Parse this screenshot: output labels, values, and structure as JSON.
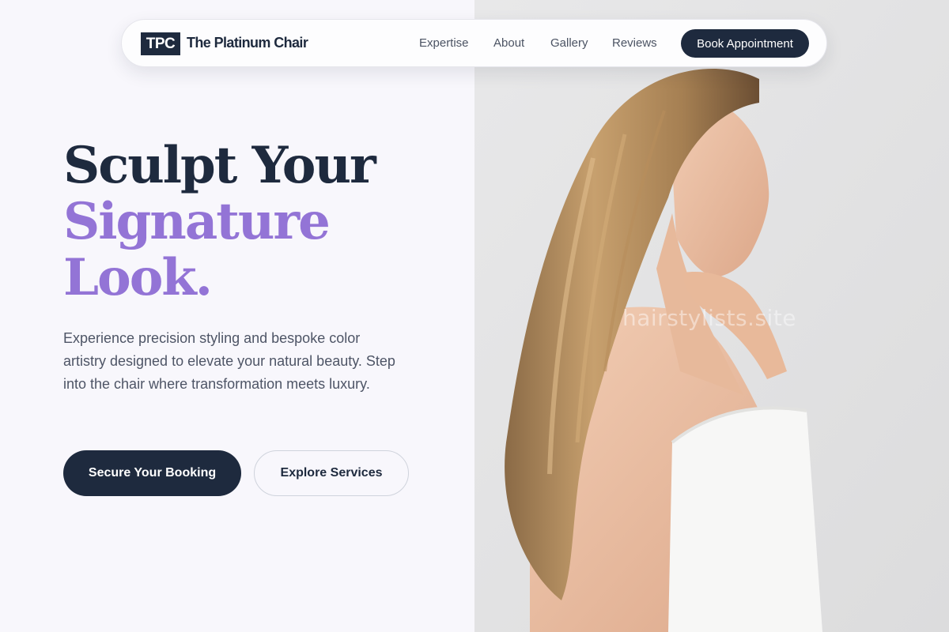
{
  "brand": {
    "logo_initials": "TPC",
    "name": "The Platinum Chair"
  },
  "nav": {
    "links": [
      "Expertise",
      "About",
      "Gallery",
      "Reviews"
    ],
    "cta_label": "Book Appointment"
  },
  "hero": {
    "headline_line1": "Sculpt Your",
    "headline_line2": "Signature",
    "headline_line3": "Look.",
    "description": "Experience precision styling and bespoke color artistry designed to elevate your natural beauty. Step into the chair where transformation meets luxury.",
    "primary_cta": "Secure Your Booking",
    "secondary_cta": "Explore Services"
  },
  "image": {
    "watermark": "hairstylists.site",
    "subject": "woman-with-long-hair-photo"
  },
  "colors": {
    "navy": "#1e2a3e",
    "accent_purple": "#9374d6",
    "page_bg": "#f8f7fc",
    "image_bg": "#e3e3e4"
  }
}
